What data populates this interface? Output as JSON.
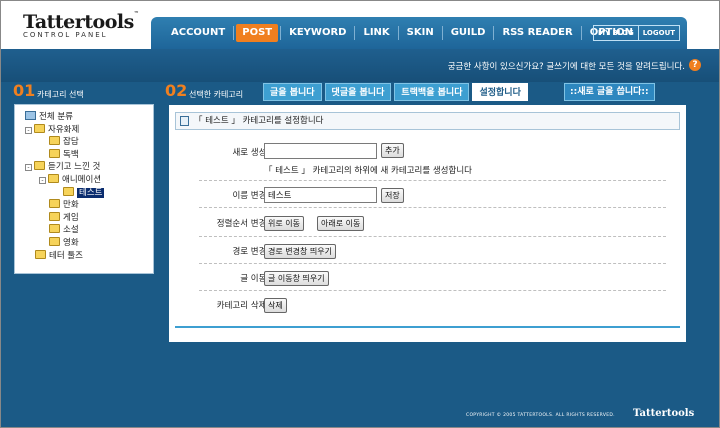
{
  "logo": {
    "brand": "Tattertools",
    "tm": "™",
    "sub": "CONTROL PANEL"
  },
  "topnav": [
    {
      "label": "ACCOUNT",
      "active": false
    },
    {
      "label": "POST",
      "active": true
    },
    {
      "label": "KEYWORD",
      "active": false
    },
    {
      "label": "LINK",
      "active": false
    },
    {
      "label": "SKIN",
      "active": false
    },
    {
      "label": "GUILD",
      "active": false
    },
    {
      "label": "RSS READER",
      "active": false
    },
    {
      "label": "OPTION",
      "active": false
    }
  ],
  "topright": {
    "myblog": "MY BLOG",
    "logout": "LOGOUT"
  },
  "help": {
    "text": "궁금한 사항이 있으신가요? 글쓰기에 대한 모든 것을 알려드립니다.",
    "icon": "?"
  },
  "step1": {
    "num": "01",
    "label": "카테고리 선택"
  },
  "step2": {
    "num": "02",
    "label": "선택한 카테고리"
  },
  "tree": {
    "root": "전체 분류",
    "items": [
      {
        "label": "자유화제",
        "level": 1,
        "expand": "-"
      },
      {
        "label": "잡담",
        "level": 2
      },
      {
        "label": "독백",
        "level": 2
      },
      {
        "label": "듣기고 느낀 것",
        "level": 1,
        "expand": "-"
      },
      {
        "label": "애니메이션",
        "level": 2,
        "expand": "-"
      },
      {
        "label": "테스트",
        "level": 3,
        "selected": true
      },
      {
        "label": "만화",
        "level": 2
      },
      {
        "label": "게임",
        "level": 2
      },
      {
        "label": "소설",
        "level": 2
      },
      {
        "label": "영화",
        "level": 2
      },
      {
        "label": "테터 툴즈",
        "level": 1
      }
    ]
  },
  "tabs": [
    "글을 봅니다",
    "댓글을 봅니다",
    "트랙백을 봅니다",
    "설정합니다"
  ],
  "active_tab": 3,
  "newpost": "::새로 글을 씁니다::",
  "panel": {
    "title": "「 테스트 」 카테고리를 설정합니다",
    "new_label": "새로 생성 |",
    "new_value": "",
    "add_btn": "추가",
    "new_note": "「 테스트 」 카테고리의 하위에 새 카테고리를 생성합니다",
    "rename_label": "이름 변경 |",
    "rename_value": "테스트",
    "save_btn": "저장",
    "order_label": "정렬순서 변경 |",
    "up_btn": "위로 이동",
    "down_btn": "아래로 이동",
    "path_label": "경로 변경 |",
    "path_btn": "경로 변경창 띄우기",
    "move_label": "글 이동 |",
    "move_btn": "글 이동창 띄우기",
    "delete_label": "카테고리 삭제 |",
    "delete_btn": "삭제"
  },
  "footer": {
    "copyright": "COPYRIGHT © 2005 TATTERTOOLS. ALL RIGHTS RESERVED.",
    "logo": "Tattertools"
  }
}
